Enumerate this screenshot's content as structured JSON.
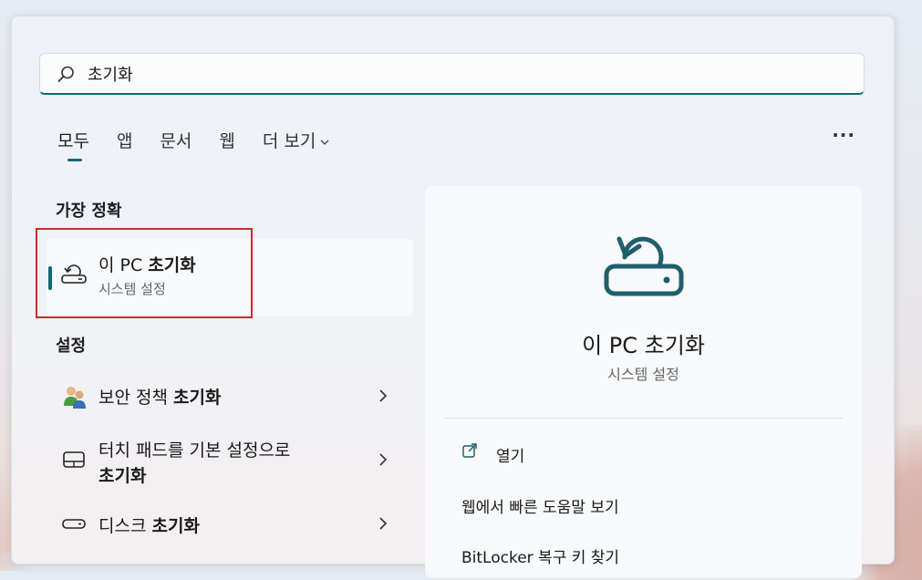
{
  "search": {
    "value": "초기화",
    "icon": "search-icon"
  },
  "tabs": [
    {
      "label": "모두",
      "active": true
    },
    {
      "label": "앱"
    },
    {
      "label": "문서"
    },
    {
      "label": "웹"
    },
    {
      "label": "더 보기",
      "has_dropdown": true
    }
  ],
  "more_options_label": "···",
  "best_match": {
    "heading": "가장 정확",
    "item": {
      "title_prefix": "이 PC ",
      "title_bold": "초기화",
      "subtitle": "시스템 설정",
      "icon": "reset-pc-icon"
    }
  },
  "settings": {
    "heading": "설정",
    "items": [
      {
        "title_prefix": "보안 정책 ",
        "title_bold": "초기화",
        "icon": "security-policy-icon"
      },
      {
        "title_prefix": "터치 패드를 기본 설정으로",
        "title_bold": "초기화",
        "icon": "touchpad-icon"
      },
      {
        "title_prefix": "디스크 ",
        "title_bold": "초기화",
        "icon": "disk-icon"
      }
    ]
  },
  "preview": {
    "title": "이 PC 초기화",
    "subtitle": "시스템 설정",
    "icon": "reset-pc-icon",
    "actions": [
      {
        "label": "열기",
        "icon": "open-icon"
      },
      {
        "label": "웹에서 빠른 도움말 보기"
      },
      {
        "label": "BitLocker 복구 키 찾기"
      }
    ]
  },
  "colors": {
    "accent": "#0f6a77",
    "highlight": "#cc2a2e"
  }
}
